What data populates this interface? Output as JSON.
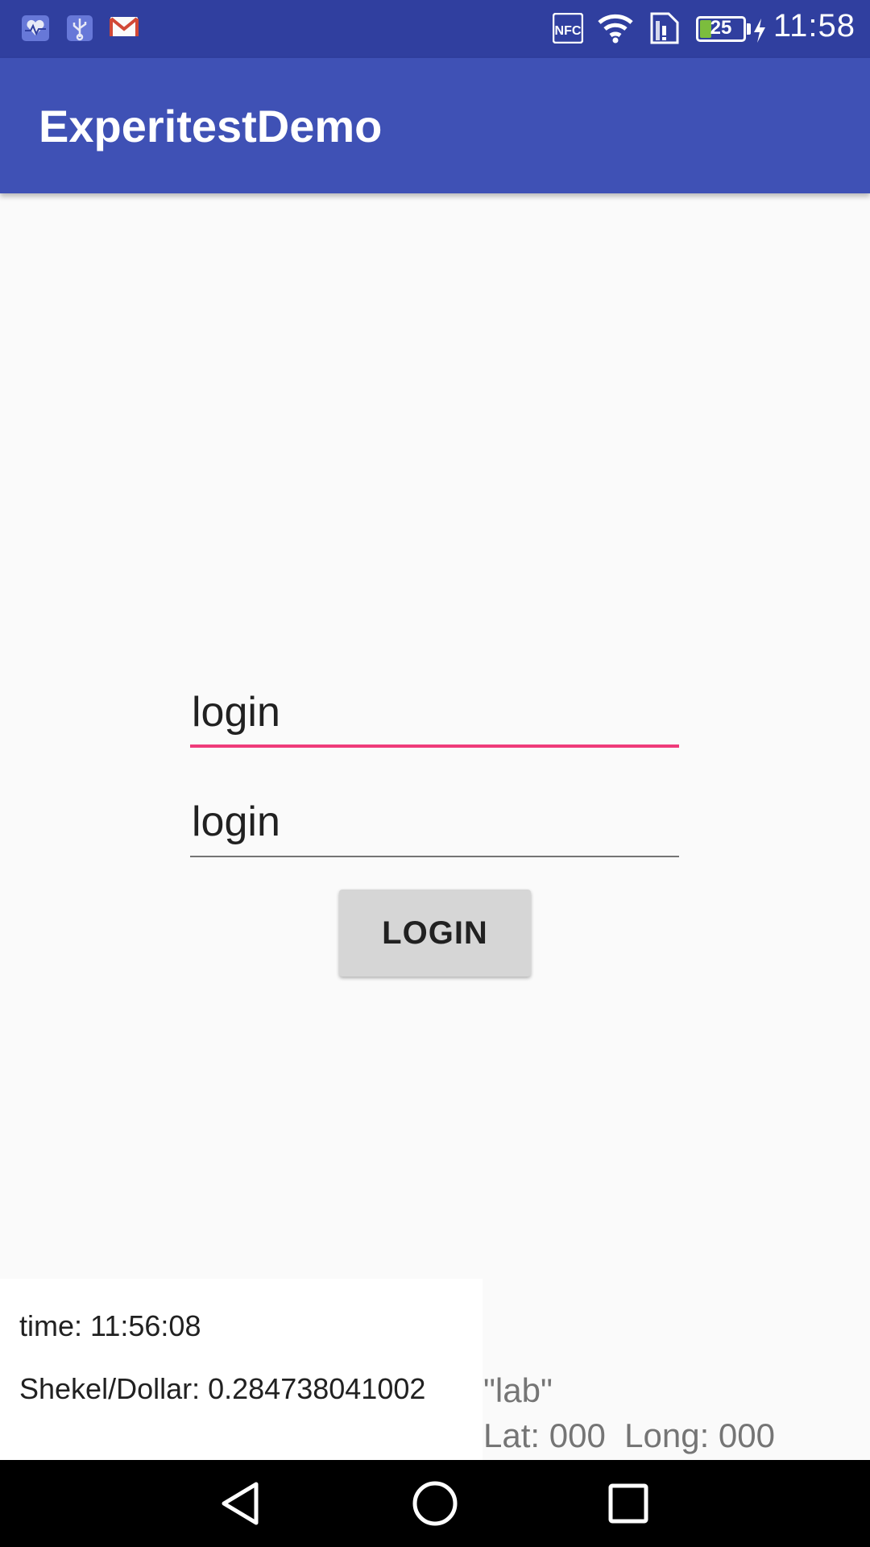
{
  "status_bar": {
    "time": "11:58",
    "battery_level": "25",
    "battery_fraction": 0.25,
    "icons": [
      "health-icon",
      "usb-icon",
      "gmail-icon",
      "nfc-icon",
      "wifi-icon",
      "sim-icon",
      "battery-icon",
      "charging-icon"
    ]
  },
  "app_bar": {
    "title": "ExperitestDemo"
  },
  "form": {
    "username_value": "login",
    "password_value": "login",
    "login_button_label": "LOGIN"
  },
  "info": {
    "time_text": "time: 11:56:08",
    "rate_text": "Shekel/Dollar: 0.284738041002",
    "lab_text": "\"lab\"",
    "coords_text": "Lat: 000  Long: 000"
  },
  "nav_bar": {
    "buttons": [
      "back-icon",
      "home-icon",
      "recents-icon"
    ]
  },
  "colors": {
    "status_bar": "#303f9f",
    "app_bar": "#3f51b5",
    "accent": "#ef3b7a",
    "background": "#fafafa"
  }
}
